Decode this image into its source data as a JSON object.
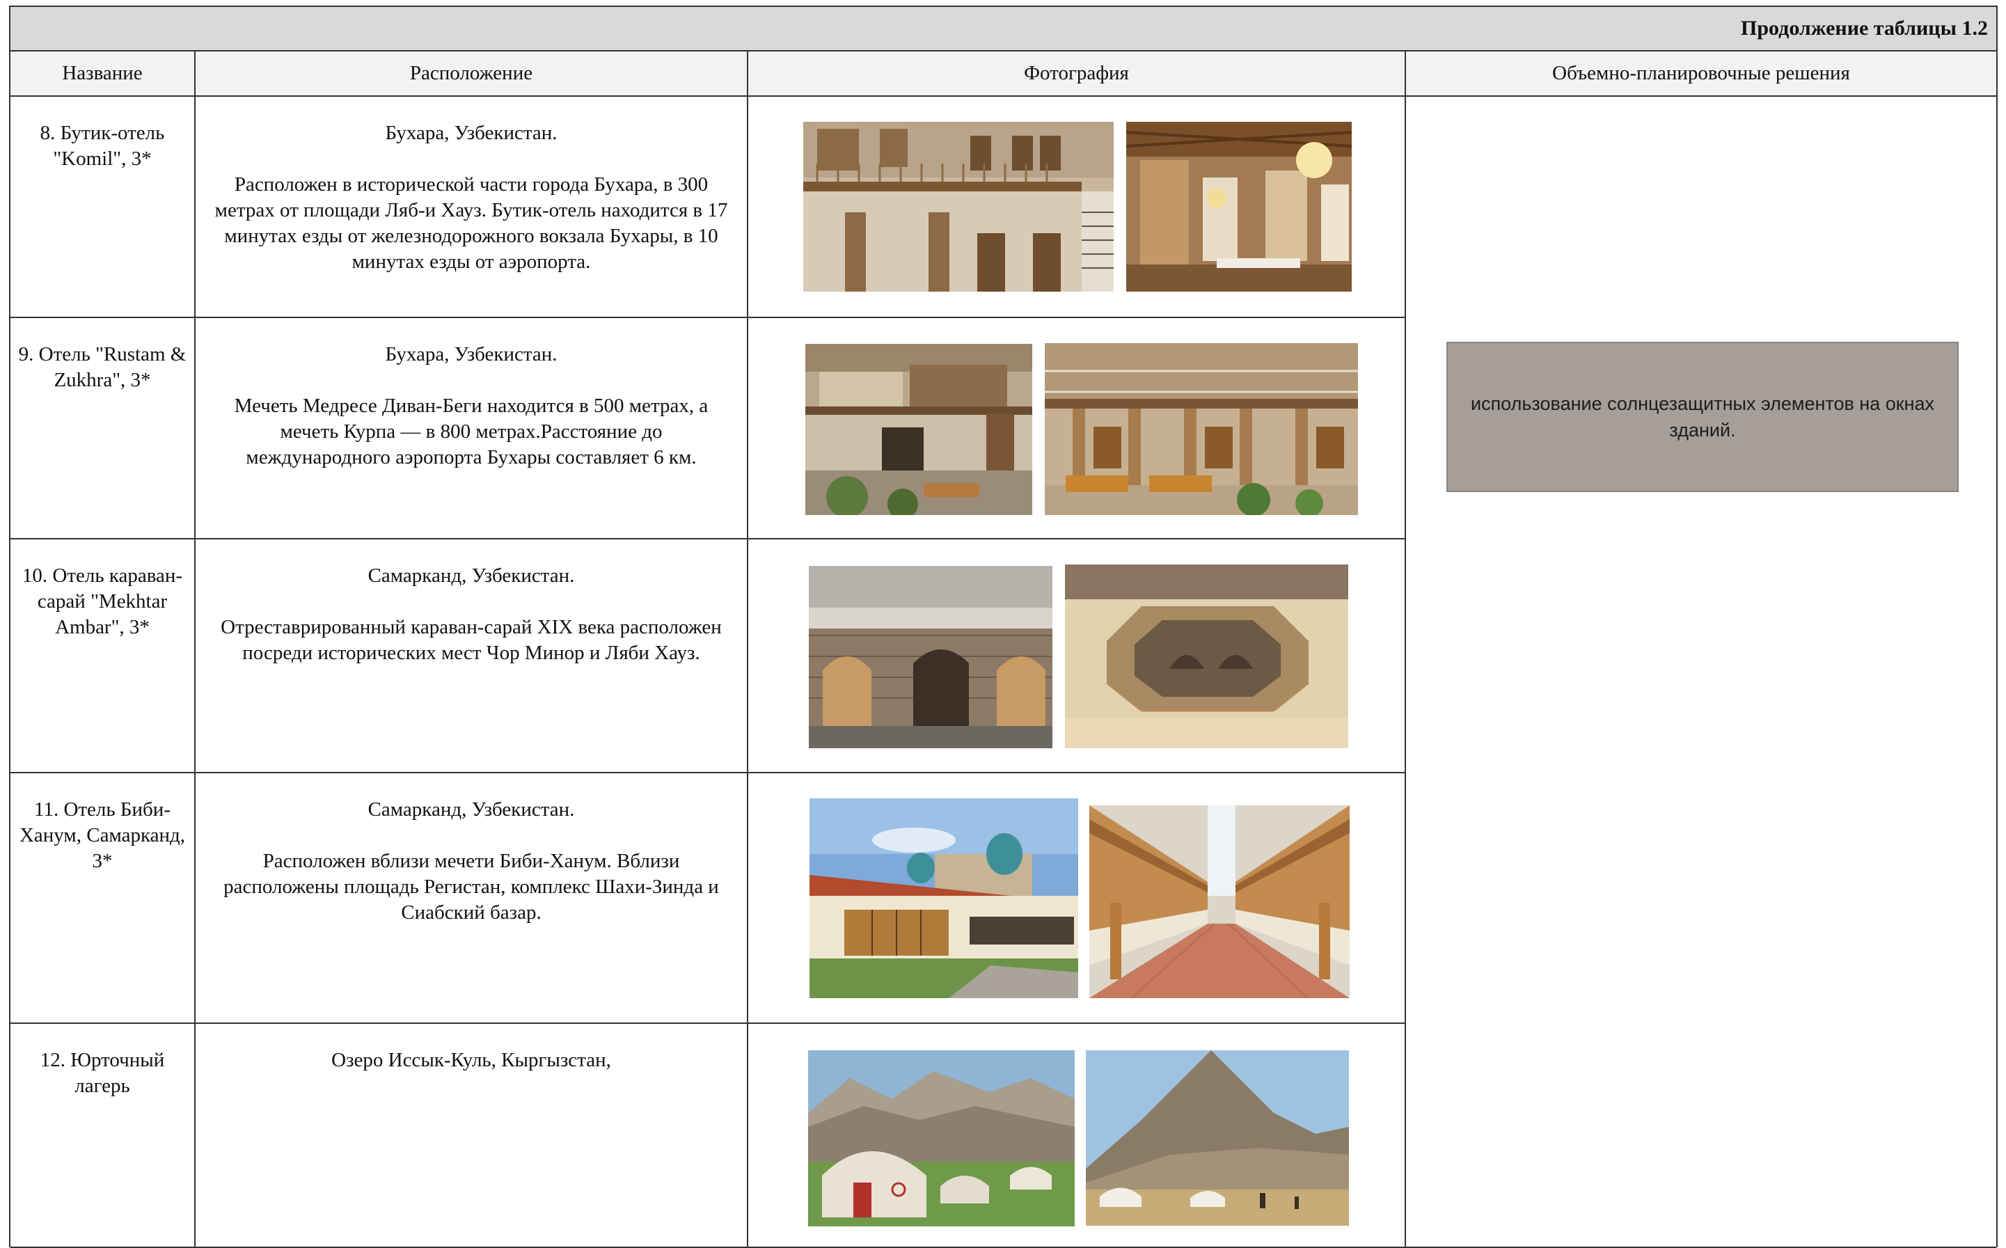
{
  "table_caption": "Продолжение таблицы 1.2",
  "columns": [
    "Название",
    "Расположение",
    "Фотография",
    "Объемно-планировочные решения"
  ],
  "rows": [
    {
      "name": "8. Бутик-отель \"Komil\", 3*",
      "location_city": "Бухара, Узбекистан.",
      "location_desc": "Расположен в исторической части города Бухара, в 300 метрах от площади Ляб-и Хауз. Бутик-отель находится в 17 минутах езды от железнодорожного вокзала Бухары, в 10 минутах езды от аэропорта.",
      "photos": [
        "courtyard-balconies-photo",
        "ornate-dining-hall-photo"
      ]
    },
    {
      "name": "9. Отель \"Rustam & Zukhra\", 3*",
      "location_city": "Бухара, Узбекистан.",
      "location_desc": "Мечеть Медресе Диван-Беги находится в 500 метрах, а мечеть Курпа — в 800 метрах.Расстояние до международного аэропорта Бухары составляет 6 км.",
      "photos": [
        "courtyard-stairs-photo",
        "courtyard-terrace-photo"
      ]
    },
    {
      "name": "10. Отель караван-сарай \"Mekhtar Ambar\", 3*",
      "location_city": "Самарканд, Узбекистан.",
      "location_desc": "Отреставрированный караван-сарай XIX века расположен посреди исторических мест Чор Минор и Ляби Хауз.",
      "photos": [
        "brick-courtyard-photo",
        "octagonal-courtyard-photo"
      ]
    },
    {
      "name": "11. Отель Биби-Ханум, Самарканд, 3*",
      "location_city": "Самарканд, Узбекистан.",
      "location_desc": "Расположен вблизи мечети Биби-Ханум. Вблизи расположены площадь Регистан, комплекс Шахи-Зинда и Сиабский базар.",
      "photos": [
        "hotel-facade-domes-photo",
        "gallery-courtyard-photo"
      ]
    },
    {
      "name": "12. Юрточный лагерь",
      "location_city": "Озеро Иссык-Куль, Кыргызстан,",
      "location_desc": "",
      "photos": [
        "yurts-rocks-photo",
        "yurts-mountain-photo"
      ]
    }
  ],
  "decision_note": "использование солнцезащитных элементов на окнах зданий."
}
